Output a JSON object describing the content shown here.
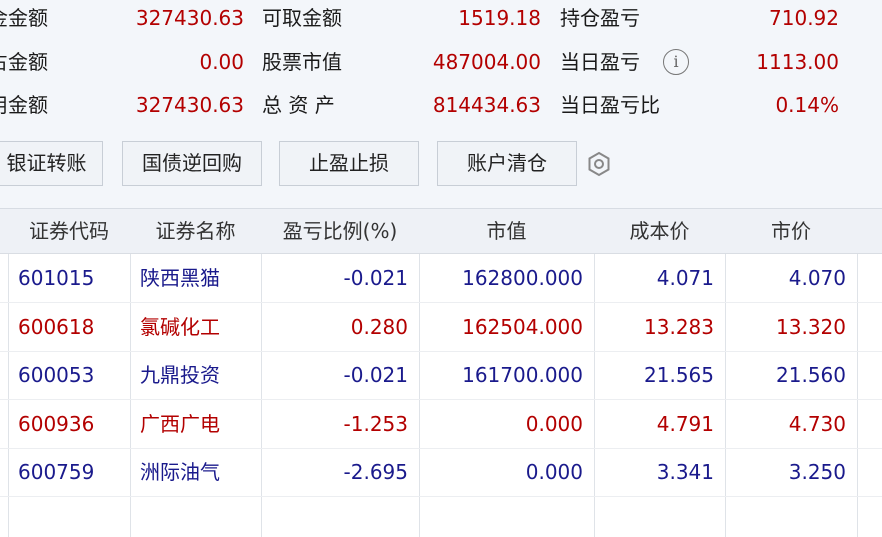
{
  "summary": {
    "rows": [
      [
        {
          "label": "金金额",
          "value": "327430.63"
        },
        {
          "label": "可取金额",
          "value": "1519.18"
        },
        {
          "label": "持仓盈亏",
          "value": "710.92"
        }
      ],
      [
        {
          "label": "占金额",
          "value": "0.00"
        },
        {
          "label": "股票市值",
          "value": "487004.00"
        },
        {
          "label": "当日盈亏",
          "value": "1113.00"
        }
      ],
      [
        {
          "label": "用金额",
          "value": "327430.63"
        },
        {
          "label": "总 资 产",
          "value": "814434.63"
        },
        {
          "label": "当日盈亏比",
          "value": "0.14%"
        }
      ]
    ],
    "info_icon_glyph": "i"
  },
  "buttons": {
    "bank_transfer": "银证转账",
    "reverse_repo": "国债逆回购",
    "take_profit_stop_loss": "止盈止损",
    "clear_account": "账户清仓"
  },
  "table": {
    "headers": [
      "证券代码",
      "证券名称",
      "盈亏比例(%)",
      "市值",
      "成本价",
      "市价"
    ],
    "rows": [
      {
        "code": "601015",
        "name": "陕西黑猫",
        "pnl_ratio": "-0.021",
        "market_value": "162800.000",
        "cost": "4.071",
        "price": "4.070",
        "color": "#1a1a8c"
      },
      {
        "code": "600618",
        "name": "氯碱化工",
        "pnl_ratio": "0.280",
        "market_value": "162504.000",
        "cost": "13.283",
        "price": "13.320",
        "color": "#b30000"
      },
      {
        "code": "600053",
        "name": "九鼎投资",
        "pnl_ratio": "-0.021",
        "market_value": "161700.000",
        "cost": "21.565",
        "price": "21.560",
        "color": "#1a1a8c"
      },
      {
        "code": "600936",
        "name": "广西广电",
        "pnl_ratio": "-1.253",
        "market_value": "0.000",
        "cost": "4.791",
        "price": "4.730",
        "color": "#b30000"
      },
      {
        "code": "600759",
        "name": "洲际油气",
        "pnl_ratio": "-2.695",
        "market_value": "0.000",
        "cost": "3.341",
        "price": "3.250",
        "color": "#1a1a8c"
      }
    ]
  },
  "colors": {
    "value_red": "#b30000",
    "row_blue": "#1a1a8c",
    "row_red": "#b30000"
  }
}
